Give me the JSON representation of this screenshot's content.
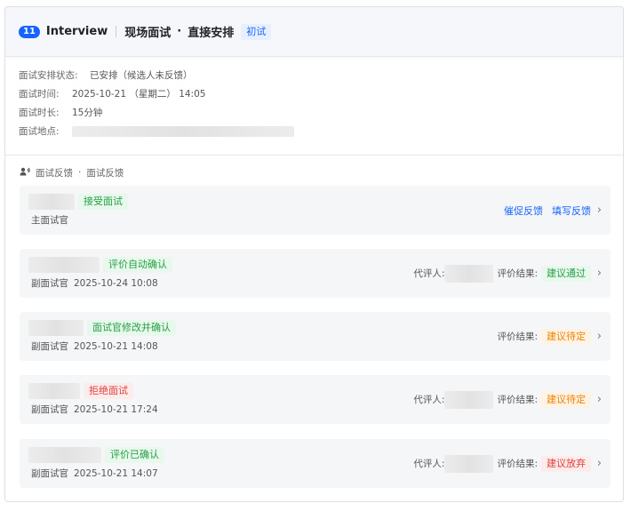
{
  "header": {
    "count": "11",
    "title": "Interview",
    "stage_name": "现场面试",
    "dot": "·",
    "arrangement": "直接安排",
    "round_tag": "初试"
  },
  "info": {
    "status_label": "面试安排状态:",
    "status_value": "已安排（候选人未反馈）",
    "time_label": "面试时间:",
    "time_value": "2025-10-21 （星期二） 14:05",
    "duration_label": "面试时长:",
    "duration_value": "15分钟",
    "location_label": "面试地点:"
  },
  "feedback": {
    "title": "面试反馈",
    "dot": "·",
    "subtitle": "面试反馈",
    "reviewer_label": "代评人:",
    "result_label": "评价结果:",
    "items": [
      {
        "status": "接受面试",
        "status_color": "green",
        "role": "主面试官",
        "time": "",
        "actions": [
          "催促反馈",
          "填写反馈"
        ]
      },
      {
        "status": "评价自动确认",
        "status_color": "green",
        "role": "副面试官",
        "time": "2025-10-24 10:08",
        "result": "建议通过",
        "result_color": "green"
      },
      {
        "status": "面试官修改并确认",
        "status_color": "green",
        "role": "副面试官",
        "time": "2025-10-21 14:08",
        "result": "建议待定",
        "result_color": "orange"
      },
      {
        "status": "拒绝面试",
        "status_color": "red",
        "role": "副面试官",
        "time": "2025-10-21 17:24",
        "result": "建议待定",
        "result_color": "orange"
      },
      {
        "status": "评价已确认",
        "status_color": "green",
        "role": "副面试官",
        "time": "2025-10-21 14:07",
        "result": "建议放弃",
        "result_color": "red"
      }
    ]
  },
  "colors": {
    "accent": "#1664ff",
    "green": "#23a045",
    "orange": "#f08200",
    "red": "#e0403b"
  },
  "icons": {
    "feedback": "person-speaking-icon",
    "chevron": "chevron-right-icon"
  }
}
